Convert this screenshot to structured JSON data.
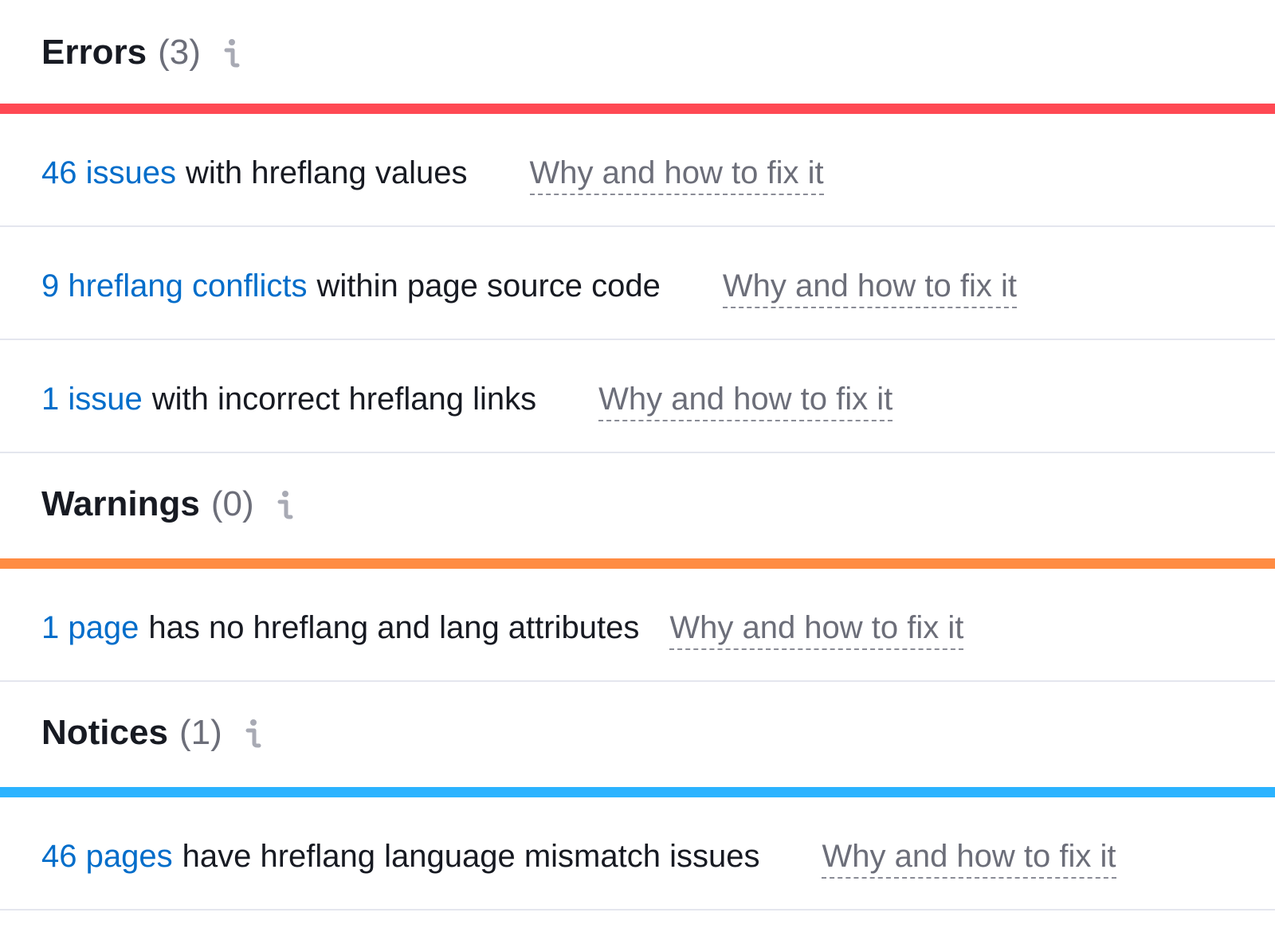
{
  "colors": {
    "errors": "#ff4953",
    "warnings": "#ff8c43",
    "notices": "#2bb3ff",
    "link": "#006dca",
    "muted": "#6c6e79",
    "text": "#171a22"
  },
  "sections": [
    {
      "name": "Errors",
      "count": "(3)",
      "icon": "info-icon",
      "rows": [
        {
          "link": "46 issues",
          "desc": "with hreflang values",
          "fix": "Why and how to fix it"
        },
        {
          "link": "9 hreflang conflicts",
          "desc": "within page source code",
          "fix": "Why and how to fix it"
        },
        {
          "link": "1 issue",
          "desc": "with incorrect hreflang links",
          "fix": "Why and how to fix it"
        }
      ]
    },
    {
      "name": "Warnings",
      "count": "(0)",
      "icon": "info-icon",
      "rows": [
        {
          "link": "1 page",
          "desc": "has no hreflang and lang attributes",
          "fix": "Why and how to fix it"
        }
      ]
    },
    {
      "name": "Notices",
      "count": "(1)",
      "icon": "info-icon",
      "rows": [
        {
          "link": "46 pages",
          "desc": "have hreflang language mismatch issues",
          "fix": "Why and how to fix it"
        }
      ]
    }
  ]
}
